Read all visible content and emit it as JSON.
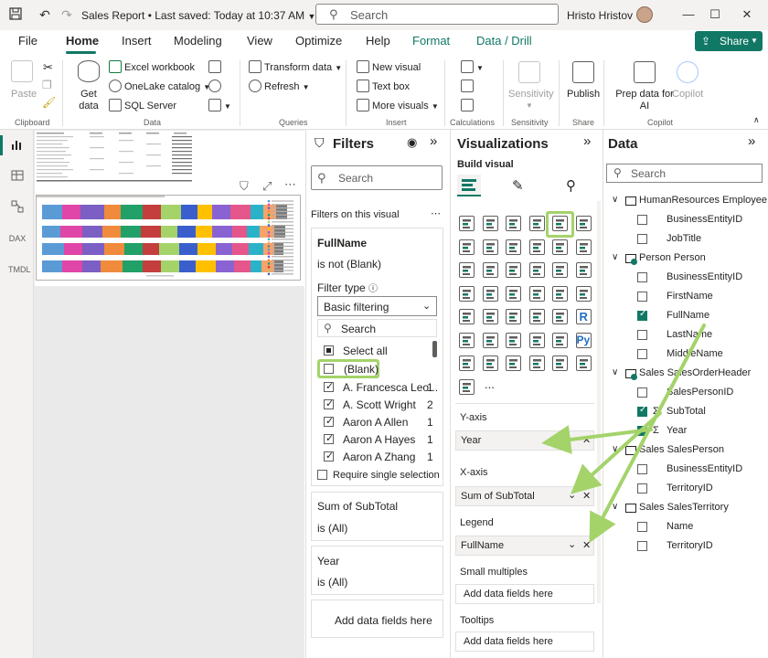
{
  "titlebar": {
    "title": "Sales Report • Last saved: Today at 10:37 AM",
    "search_placeholder": "Search",
    "user": "Hristo Hristov"
  },
  "menu": {
    "tabs": [
      "File",
      "Home",
      "Insert",
      "Modeling",
      "View",
      "Optimize",
      "Help",
      "Format",
      "Data / Drill"
    ],
    "share": "Share"
  },
  "ribbon": {
    "clipboard": {
      "paste": "Paste",
      "label": "Clipboard"
    },
    "data": {
      "get_data": "Get data",
      "excel": "Excel workbook",
      "onelake": "OneLake catalog",
      "sql": "SQL Server",
      "label": "Data"
    },
    "queries": {
      "transform": "Transform data",
      "refresh": "Refresh",
      "label": "Queries"
    },
    "insert": {
      "new_visual": "New visual",
      "text_box": "Text box",
      "more_visuals": "More visuals",
      "label": "Insert"
    },
    "calculations": {
      "label": "Calculations"
    },
    "sensitivity": {
      "button": "Sensitivity",
      "label": "Sensitivity"
    },
    "share": {
      "publish": "Publish",
      "label": "Share"
    },
    "copilot": {
      "prep": "Prep data for AI",
      "copilot": "Copilot",
      "label": "Copilot"
    }
  },
  "leftbar": {
    "dax": "DAX",
    "tmdl": "TMDL"
  },
  "filters": {
    "title": "Filters",
    "search": "Search",
    "on_visual": "Filters on this visual",
    "fullname_card": {
      "field": "FullName",
      "state": "is not (Blank)",
      "filter_type_label": "Filter type",
      "filter_type": "Basic filtering",
      "search": "Search",
      "items": [
        {
          "label": "Select all",
          "count": ""
        },
        {
          "label": "(Blank)",
          "count": ""
        },
        {
          "label": "A. Francesca Leo...",
          "count": "1"
        },
        {
          "label": "A. Scott Wright",
          "count": "2"
        },
        {
          "label": "Aaron A Allen",
          "count": "1"
        },
        {
          "label": "Aaron A Hayes",
          "count": "1"
        },
        {
          "label": "Aaron A Zhang",
          "count": "1"
        }
      ],
      "require_single": "Require single selection"
    },
    "subtotal_card": {
      "field": "Sum of SubTotal",
      "state": "is (All)"
    },
    "year_card": {
      "field": "Year",
      "state": "is (All)"
    },
    "add_fields": "Add data fields here"
  },
  "viz": {
    "title": "Visualizations",
    "build_visual": "Build visual",
    "more": "...",
    "wells": {
      "y_axis": "Y-axis",
      "y_value": "Year",
      "x_axis": "X-axis",
      "x_value": "Sum of SubTotal",
      "legend": "Legend",
      "legend_value": "FullName",
      "small_multiples": "Small multiples",
      "sm_value": "Add data fields here",
      "tooltips": "Tooltips",
      "tt_value": "Add data fields here"
    }
  },
  "data": {
    "title": "Data",
    "search": "Search",
    "tables": [
      {
        "name": "HumanResources Employee",
        "fields": [
          {
            "name": "BusinessEntityID",
            "checked": false
          },
          {
            "name": "JobTitle",
            "checked": false
          }
        ]
      },
      {
        "name": "Person Person",
        "fields": [
          {
            "name": "BusinessEntityID",
            "checked": false
          },
          {
            "name": "FirstName",
            "checked": false
          },
          {
            "name": "FullName",
            "checked": true
          },
          {
            "name": "LastName",
            "checked": false
          },
          {
            "name": "MiddleName",
            "checked": false
          }
        ]
      },
      {
        "name": "Sales SalesOrderHeader",
        "fields": [
          {
            "name": "SalesPersonID",
            "checked": false
          },
          {
            "name": "SubTotal",
            "checked": true
          },
          {
            "name": "Year",
            "checked": true
          }
        ]
      },
      {
        "name": "Sales SalesPerson",
        "fields": [
          {
            "name": "BusinessEntityID",
            "checked": false
          },
          {
            "name": "TerritoryID",
            "checked": false
          }
        ]
      },
      {
        "name": "Sales SalesTerritory",
        "fields": [
          {
            "name": "Name",
            "checked": false
          },
          {
            "name": "TerritoryID",
            "checked": false
          }
        ]
      }
    ],
    "sigma": "Σ"
  },
  "colors": {
    "accent": "#117865",
    "highlight": "#a4d36a"
  }
}
